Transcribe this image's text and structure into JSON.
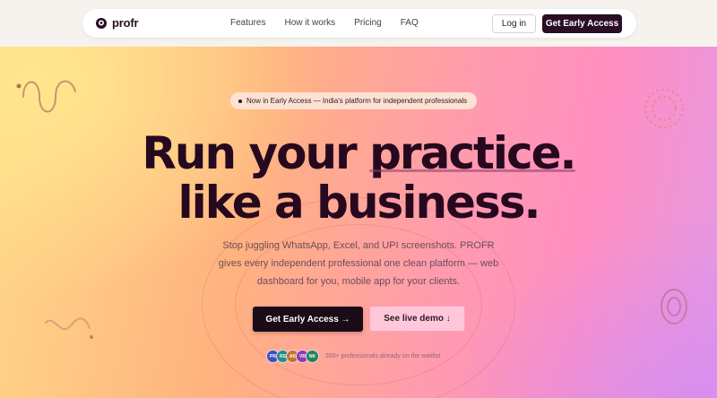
{
  "brand": {
    "name": "profr"
  },
  "nav": {
    "links": [
      "Features",
      "How it works",
      "Pricing",
      "FAQ"
    ],
    "login_label": "Log in",
    "cta_label": "Get Early Access"
  },
  "hero": {
    "badge_text": "Now in Early Access — India's platform for independent professionals",
    "headline_part1": "Run your ",
    "headline_accent": "practice.",
    "headline_line2": "like a business.",
    "subtitle": "Stop juggling WhatsApp, Excel, and UPI screenshots. PROFR gives every independent professional one clean platform — web dashboard for you, mobile app for your clients.",
    "cta_primary": "Get Early Access →",
    "cta_secondary": "See live demo ↓",
    "avatars": [
      {
        "initials": "PR",
        "color": "#3b4fbf"
      },
      {
        "initials": "RS",
        "color": "#1f8f8a"
      },
      {
        "initials": "AK",
        "color": "#c0762c"
      },
      {
        "initials": "VR",
        "color": "#8a3cb0"
      },
      {
        "initials": "NK",
        "color": "#20865c"
      }
    ],
    "social_text": "200+ professionals already on the waitlist"
  },
  "colors": {
    "primary_dark": "#2a0e25",
    "secondary_pink": "#ffc8da"
  }
}
